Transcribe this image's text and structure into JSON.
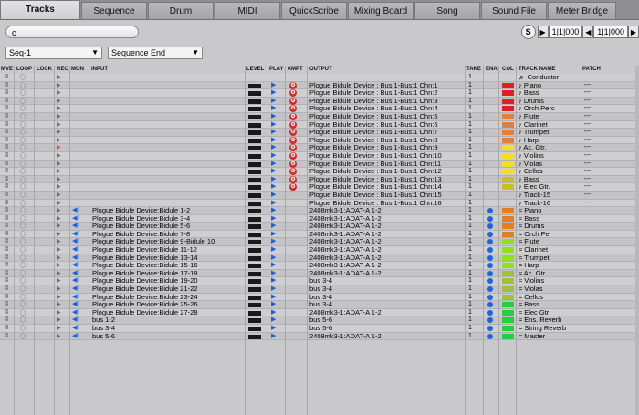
{
  "tabs": [
    "Tracks",
    "Sequence",
    "Drum",
    "MIDI",
    "QuickScribe",
    "Mixing Board",
    "Song",
    "Sound File",
    "Meter Bridge"
  ],
  "active_tab": 0,
  "toolbar": {
    "search_value": "",
    "sequence_select": "Seq-1",
    "end_select": "Sequence End",
    "s_label": "S",
    "time_start": "1|1|000",
    "time_end": "1|1|000"
  },
  "headers": {
    "mve": "MVE",
    "loop": "LOOP",
    "lock": "LOCK",
    "rec": "REC",
    "mon": "MON",
    "input": "INPUT",
    "level": "LEVEL",
    "play": "PLAY",
    "xmpt": "XMPT",
    "output": "OUTPUT",
    "take": "TAKE",
    "ena": "ENA",
    "col": "COL",
    "track_name": "TRACK NAME",
    "patch": "PATCH"
  },
  "rows": [
    {
      "type": "conductor",
      "input": "",
      "output": "",
      "take": "1",
      "color": "",
      "name": "Conductor",
      "patch": ""
    },
    {
      "type": "midi",
      "input": "",
      "output": "Plogue Bidule Device : Bus 1-Bus:1 Chn:1",
      "take": "1",
      "color": "#e02020",
      "name": "Piano",
      "patch": "---"
    },
    {
      "type": "midi",
      "input": "",
      "output": "Plogue Bidule Device : Bus 1-Bus:1 Chn:2",
      "take": "1",
      "color": "#e02020",
      "name": "Bass",
      "patch": "---"
    },
    {
      "type": "midi",
      "input": "",
      "output": "Plogue Bidule Device : Bus 1-Bus:1 Chn:3",
      "take": "1",
      "color": "#e02020",
      "name": "Drums",
      "patch": "---"
    },
    {
      "type": "midi",
      "input": "",
      "output": "Plogue Bidule Device : Bus 1-Bus:1 Chn:4",
      "take": "1",
      "color": "#e02020",
      "name": "Orch Perc",
      "patch": "---"
    },
    {
      "type": "midi",
      "input": "",
      "output": "Plogue Bidule Device : Bus 1-Bus:1 Chn:5",
      "take": "1",
      "color": "#e08040",
      "name": "Flute",
      "patch": "---"
    },
    {
      "type": "midi",
      "input": "",
      "output": "Plogue Bidule Device : Bus 1-Bus:1 Chn:6",
      "take": "1",
      "color": "#e08040",
      "name": "Clarinet",
      "patch": "---"
    },
    {
      "type": "midi",
      "input": "",
      "output": "Plogue Bidule Device : Bus 1-Bus:1 Chn:7",
      "take": "1",
      "color": "#e08040",
      "name": "Trumpet",
      "patch": "---"
    },
    {
      "type": "midi",
      "input": "",
      "output": "Plogue Bidule Device : Bus 1-Bus:1 Chn:8",
      "take": "1",
      "color": "#e08040",
      "name": "Harp",
      "patch": "---"
    },
    {
      "type": "midi",
      "armed": true,
      "input": "",
      "output": "Plogue Bidule Device : Bus 1-Bus:1 Chn:9",
      "take": "1",
      "color": "#f0e020",
      "name": "Ac. Gtr.",
      "patch": "---"
    },
    {
      "type": "midi",
      "input": "",
      "output": "Plogue Bidule Device : Bus 1-Bus:1 Chn:10",
      "take": "1",
      "color": "#f0e020",
      "name": "Violins",
      "patch": "---"
    },
    {
      "type": "midi",
      "input": "",
      "output": "Plogue Bidule Device : Bus 1-Bus:1 Chn:11",
      "take": "1",
      "color": "#f0e020",
      "name": "Violas",
      "patch": "---"
    },
    {
      "type": "midi",
      "input": "",
      "output": "Plogue Bidule Device : Bus 1-Bus:1 Chn:12",
      "take": "1",
      "color": "#f0e020",
      "name": "Cellos",
      "patch": "---"
    },
    {
      "type": "midi",
      "input": "",
      "output": "Plogue Bidule Device : Bus 1-Bus:1 Chn:13",
      "take": "1",
      "color": "#c8c020",
      "name": "Bass",
      "patch": "---"
    },
    {
      "type": "midi",
      "input": "",
      "output": "Plogue Bidule Device : Bus 1-Bus:1 Chn:14",
      "take": "1",
      "color": "#c8c020",
      "name": "Elec Gtr.",
      "patch": "---"
    },
    {
      "type": "midi",
      "input": "",
      "output": "Plogue Bidule Device : Bus 1-Bus:1 Chn:15",
      "take": "1",
      "color": "",
      "name": "Track-15",
      "patch": "---"
    },
    {
      "type": "midi",
      "input": "",
      "output": "Plogue Bidule Device : Bus 1-Bus:1 Chn:16",
      "take": "1",
      "color": "",
      "name": "Track-16",
      "patch": "---"
    },
    {
      "type": "audio",
      "input": "Plogue Bidule Device:Bidule  1-2",
      "output": "2408mk3-1:ADAT-A 1-2",
      "take": "1",
      "color": "#e08020",
      "name": "Piano",
      "patch": ""
    },
    {
      "type": "audio",
      "input": "Plogue Bidule Device:Bidule  3-4",
      "output": "2408mk3-1:ADAT-A 1-2",
      "take": "1",
      "color": "#e08020",
      "name": "Bass",
      "patch": ""
    },
    {
      "type": "audio",
      "input": "Plogue Bidule Device:Bidule  5-6",
      "output": "2408mk3-1:ADAT-A 1-2",
      "take": "1",
      "color": "#e08020",
      "name": "Drums",
      "patch": ""
    },
    {
      "type": "audio",
      "input": "Plogue Bidule Device:Bidule  7-8",
      "output": "2408mk3-1:ADAT-A 1-2",
      "take": "1",
      "color": "#e08020",
      "name": "Orch Per",
      "patch": ""
    },
    {
      "type": "audio",
      "input": "Plogue Bidule Device:Bidule  9-Bidule  10",
      "output": "2408mk3-1:ADAT-A 1-2",
      "take": "1",
      "color": "#90e020",
      "name": "Flute",
      "patch": ""
    },
    {
      "type": "audio",
      "input": "Plogue Bidule Device:Bidule  11-12",
      "output": "2408mk3-1:ADAT-A 1-2",
      "take": "1",
      "color": "#90e020",
      "name": "Clarinet",
      "patch": ""
    },
    {
      "type": "audio",
      "input": "Plogue Bidule Device:Bidule  13-14",
      "output": "2408mk3-1:ADAT-A 1-2",
      "take": "1",
      "color": "#90e020",
      "name": "Trumpet",
      "patch": ""
    },
    {
      "type": "audio",
      "input": "Plogue Bidule Device:Bidule  15-16",
      "output": "2408mk3-1:ADAT-A 1-2",
      "take": "1",
      "color": "#90e020",
      "name": "Harp",
      "patch": ""
    },
    {
      "type": "audio",
      "input": "Plogue Bidule Device:Bidule  17-18",
      "output": "2408mk3-1:ADAT-A 1-2",
      "take": "1",
      "color": "#a0c040",
      "name": "Ac. Gtr.",
      "patch": ""
    },
    {
      "type": "audio",
      "input": "Plogue Bidule Device:Bidule  19-20",
      "output": "bus 3-4",
      "take": "1",
      "color": "#a0c040",
      "name": "Violins",
      "patch": ""
    },
    {
      "type": "audio",
      "input": "Plogue Bidule Device:Bidule  21-22",
      "output": "bus 3-4",
      "take": "1",
      "color": "#a0c040",
      "name": "Violas",
      "patch": ""
    },
    {
      "type": "audio",
      "input": "Plogue Bidule Device:Bidule  23-24",
      "output": "bus 3-4",
      "take": "1",
      "color": "#a0c040",
      "name": "Cellos",
      "patch": ""
    },
    {
      "type": "audio",
      "input": "Plogue Bidule Device:Bidule  25-26",
      "output": "bus 3-4",
      "take": "1",
      "color": "#20d040",
      "name": "Bass",
      "patch": ""
    },
    {
      "type": "audio",
      "input": "Plogue Bidule Device:Bidule  27-28",
      "output": "2408mk3-1:ADAT-A 1-2",
      "take": "1",
      "color": "#20d040",
      "name": "Elec Gtr",
      "patch": ""
    },
    {
      "type": "audio",
      "input": "bus 1-2",
      "output": "bus 5-6",
      "take": "1",
      "color": "#20d040",
      "name": "Ens. Reverb",
      "patch": ""
    },
    {
      "type": "audio",
      "input": "bus 3-4",
      "output": "bus 5-6",
      "take": "1",
      "color": "#20d040",
      "name": "String Reverb",
      "patch": ""
    },
    {
      "type": "audio",
      "input": "bus 5-6",
      "output": "2408mk3-1:ADAT-A 1-2",
      "take": "1",
      "color": "#20d040",
      "name": "Master",
      "patch": ""
    }
  ]
}
